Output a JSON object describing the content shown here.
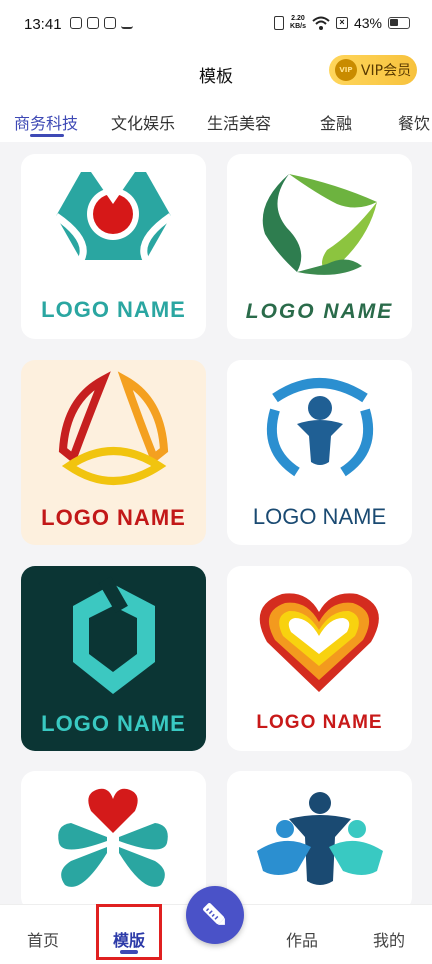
{
  "status_bar": {
    "time": "13:41",
    "net_speed_value": "2.20",
    "net_speed_unit": "KB/s",
    "battery": "43%"
  },
  "header": {
    "title": "模板",
    "vip_badge": "VIP",
    "vip_label": "VIP会员"
  },
  "tabs": [
    "商务科技",
    "文化娱乐",
    "生活美容",
    "金融",
    "餐饮"
  ],
  "templates": [
    {
      "logo_text": "LOGO NAME",
      "text_color": "#2aa6a1"
    },
    {
      "logo_text": "LOGO NAME",
      "text_color": "#2a6b4a"
    },
    {
      "logo_text": "LOGO NAME",
      "text_color": "#c21818"
    },
    {
      "logo_text": "LOGO NAME",
      "text_color": "#1a4a72"
    },
    {
      "logo_text": "LOGO NAME",
      "text_color": "#39c9c2"
    },
    {
      "logo_text": "LOGO NAME",
      "text_color": "#c81919"
    },
    {
      "logo_text": "",
      "text_color": "#2aa6a1"
    },
    {
      "logo_text": "",
      "text_color": "#1a4a72"
    }
  ],
  "bottom_nav": {
    "home": "首页",
    "templates": "模版",
    "works": "作品",
    "mine": "我的"
  },
  "colors": {
    "accent": "#3e49b5",
    "vip_gold": "#f7c23d",
    "highlight_box": "#e02020"
  }
}
